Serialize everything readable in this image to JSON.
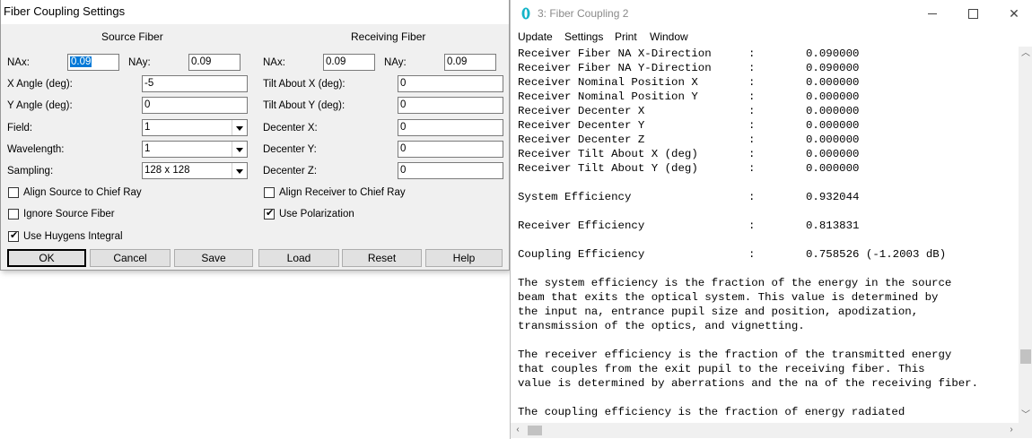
{
  "dialog": {
    "title": "Fiber Coupling Settings",
    "source_header": "Source Fiber",
    "receiving_header": "Receiving Fiber",
    "source": {
      "nax_label": "NAx:",
      "nax_value": "0.09",
      "nay_label": "NAy:",
      "nay_value": "0.09",
      "xangle_label": "X Angle (deg):",
      "xangle_value": "-5",
      "yangle_label": "Y Angle (deg):",
      "yangle_value": "0",
      "field_label": "Field:",
      "field_value": "1",
      "wavelength_label": "Wavelength:",
      "wavelength_value": "1",
      "sampling_label": "Sampling:",
      "sampling_value": "128 x 128"
    },
    "receiver": {
      "nax_label": "NAx:",
      "nax_value": "0.09",
      "nay_label": "NAy:",
      "nay_value": "0.09",
      "tiltx_label": "Tilt About X (deg):",
      "tiltx_value": "0",
      "tilty_label": "Tilt About Y (deg):",
      "tilty_value": "0",
      "decx_label": "Decenter X:",
      "decx_value": "0",
      "decy_label": "Decenter Y:",
      "decy_value": "0",
      "decz_label": "Decenter Z:",
      "decz_value": "0"
    },
    "checkboxes": {
      "align_source": {
        "label": "Align Source to Chief Ray",
        "checked": false
      },
      "align_receiver": {
        "label": "Align Receiver to Chief Ray",
        "checked": false
      },
      "ignore_source": {
        "label": "Ignore Source Fiber",
        "checked": false
      },
      "use_polarization": {
        "label": "Use Polarization",
        "checked": true
      },
      "use_huygens": {
        "label": "Use Huygens Integral",
        "checked": true
      }
    },
    "buttons": {
      "ok": "OK",
      "cancel": "Cancel",
      "save": "Save",
      "load": "Load",
      "reset": "Reset",
      "help": "Help"
    }
  },
  "window": {
    "title": "3: Fiber Coupling 2",
    "menu": [
      "Update",
      "Settings",
      "Print",
      "Window"
    ],
    "params": [
      {
        "key": "Receiver Fiber NA X-Direction",
        "sep": ":",
        "value": "0.090000"
      },
      {
        "key": "Receiver Fiber NA Y-Direction",
        "sep": ":",
        "value": "0.090000"
      },
      {
        "key": "Receiver Nominal Position X",
        "sep": ":",
        "value": "0.000000"
      },
      {
        "key": "Receiver Nominal Position Y",
        "sep": ":",
        "value": "0.000000"
      },
      {
        "key": "Receiver Decenter X",
        "sep": ":",
        "value": "0.000000"
      },
      {
        "key": "Receiver Decenter Y",
        "sep": ":",
        "value": "0.000000"
      },
      {
        "key": "Receiver Decenter Z",
        "sep": ":",
        "value": "0.000000"
      },
      {
        "key": "Receiver Tilt About X (deg)",
        "sep": ":",
        "value": "0.000000"
      },
      {
        "key": "Receiver Tilt About Y (deg)",
        "sep": ":",
        "value": "0.000000"
      }
    ],
    "results": [
      {
        "key": "System Efficiency",
        "sep": ":",
        "value": "0.932044"
      },
      {
        "key": "Receiver Efficiency",
        "sep": ":",
        "value": "0.813831"
      },
      {
        "key": "Coupling Efficiency",
        "sep": ":",
        "value": "0.758526 (-1.2003 dB)"
      }
    ],
    "paragraphs": [
      [
        "The system efficiency is the fraction of the energy in the source",
        "beam that exits the optical system. This value is determined by",
        "the input na, entrance pupil size and position, apodization,",
        "transmission of the optics, and vignetting."
      ],
      [
        "The receiver efficiency is the fraction of the transmitted energy",
        "that couples from the exit pupil to the receiving fiber. This",
        "value is determined by aberrations and the na of the receiving fiber."
      ],
      [
        "The coupling efficiency is the fraction of energy radiated"
      ]
    ],
    "icon_colors": {
      "accent": "#14b4c8"
    }
  }
}
